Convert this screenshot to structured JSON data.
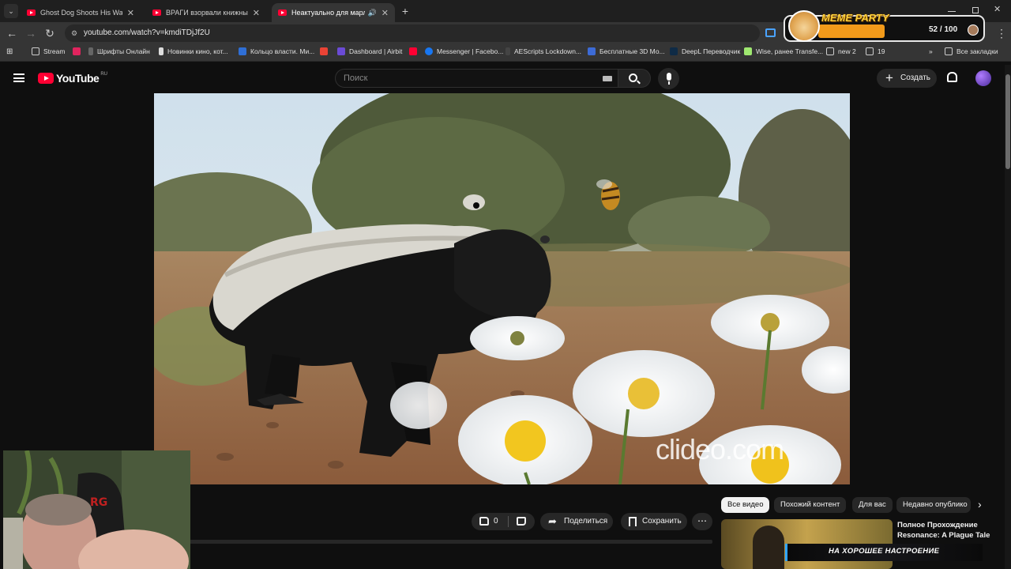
{
  "browser": {
    "tabs": [
      {
        "label": "Ghost Dog Shoots His Way Thr"
      },
      {
        "label": "ВРАГИ взорвали книжный Pl"
      },
      {
        "label": "Неактуально для марлы -"
      }
    ],
    "new_tab": "+",
    "url": "youtube.com/watch?v=kmdiTDjJf2U",
    "bookmarks": [
      {
        "label": "Stream"
      },
      {
        "label": "Шрифты Онлайн"
      },
      {
        "label": "Новинки кино, кот..."
      },
      {
        "label": "Кольцо власти. Ми..."
      },
      {
        "label": "Dashboard | Airbit"
      },
      {
        "label": "Messenger | Facebo..."
      },
      {
        "label": "AEScripts Lockdown..."
      },
      {
        "label": "Бесплатные 3D Мо..."
      },
      {
        "label": "DeepL Переводчик"
      },
      {
        "label": "Wise, ранее Transfe..."
      },
      {
        "label": "new 2"
      },
      {
        "label": "19"
      },
      {
        "label": "Все закладки"
      }
    ]
  },
  "overlay": {
    "meme_title": "MEME PARTY",
    "meme_count": "52 / 100",
    "mood_banner": "НА ХОРОШЕЕ НАСТРОЕНИЕ"
  },
  "youtube": {
    "logo": "YouTube",
    "region": "RU",
    "search_placeholder": "Поиск",
    "create_label": "Создать",
    "watermark": "clideo.com",
    "likes": "0",
    "share_label": "Поделиться",
    "save_label": "Сохранить",
    "chips": [
      "Все видео",
      "Похожий контент",
      "Для вас",
      "Недавно опублико"
    ],
    "rec_title_1": "Полное Прохождение",
    "rec_title_2": "Resonance: A Plague Tale"
  },
  "colors": {
    "accent_red": "#ff0033",
    "meme_orange": "#f29a1a"
  }
}
